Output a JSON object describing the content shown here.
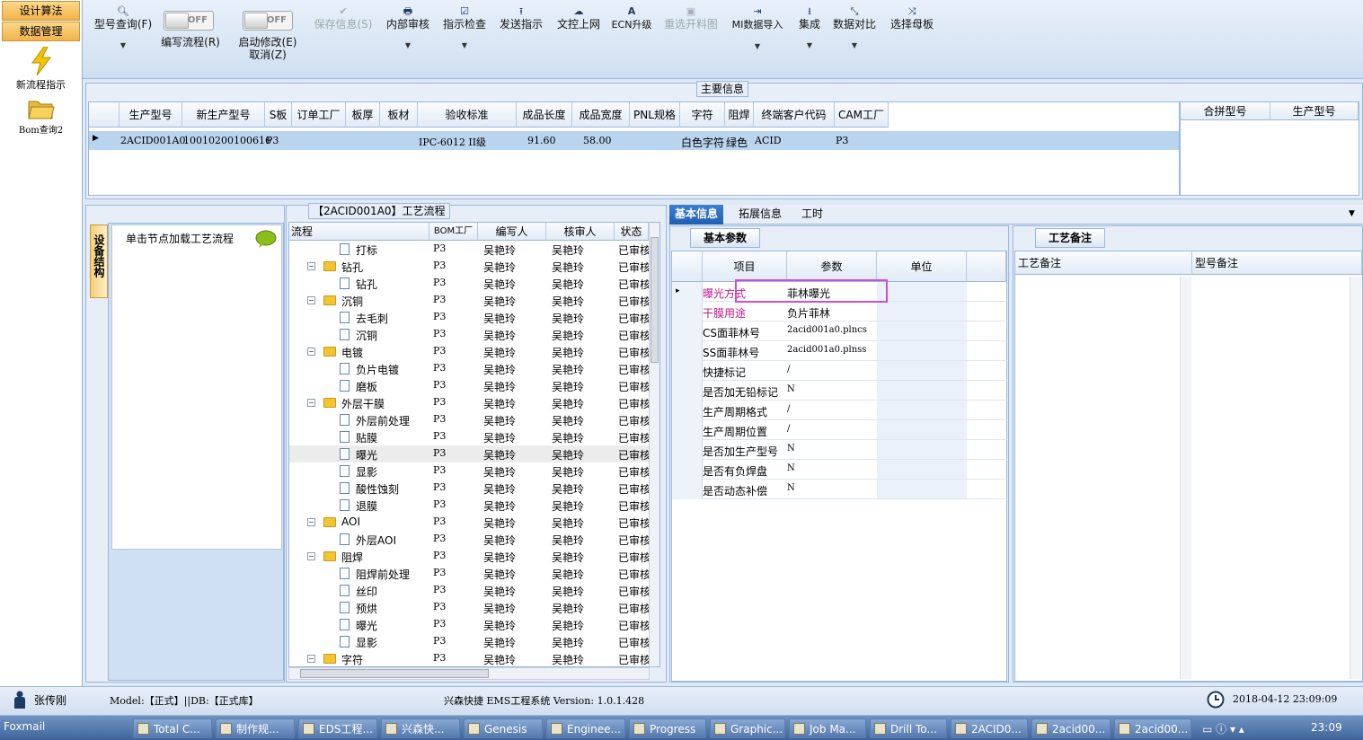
{
  "nav": {
    "tabs": [
      "设计算法",
      "数据管理"
    ],
    "tools": [
      {
        "label": "新流程指示",
        "icon": "lightning-icon"
      },
      {
        "label": "Bom查询2",
        "icon": "folder-open-icon"
      }
    ]
  },
  "ribbon": {
    "buttons": [
      {
        "label": "型号查询(F)",
        "icon": "search-icon",
        "dropdown": true,
        "enabled": true
      },
      {
        "label": "编写流程(R)",
        "toggle": "OFF",
        "enabled": true
      },
      {
        "label": "启动修改(E)",
        "label2": "取消(Z)",
        "toggle": "OFF",
        "enabled": true
      },
      {
        "label": "保存信息(S)",
        "icon": "check-icon",
        "enabled": false
      },
      {
        "label": "内部审核",
        "icon": "print-icon",
        "dropdown": true,
        "enabled": true
      },
      {
        "label": "指示检查",
        "icon": "checkbox-icon",
        "dropdown": true,
        "enabled": true
      },
      {
        "label": "发送指示",
        "icon": "upload-icon",
        "enabled": true
      },
      {
        "label": "文控上网",
        "icon": "cloud-upload-icon",
        "enabled": true
      },
      {
        "label": "ECN升级",
        "icon": "font-icon",
        "enabled": true
      },
      {
        "label": "重选开料图",
        "icon": "image-icon",
        "enabled": false
      },
      {
        "label": "MI数据导入",
        "icon": "import-icon",
        "dropdown": true,
        "enabled": true
      },
      {
        "label": "集成",
        "icon": "download-icon",
        "dropdown": true,
        "enabled": true
      },
      {
        "label": "数据对比",
        "icon": "compress-icon",
        "dropdown": true,
        "enabled": true
      },
      {
        "label": "选择母板",
        "icon": "shuffle-icon",
        "enabled": true
      }
    ]
  },
  "main_info": {
    "title": "主要信息",
    "columns": [
      "生产型号",
      "新生产型号",
      "S板",
      "订单工厂",
      "板厚",
      "板材",
      "验收标准",
      "成品长度",
      "成品宽度",
      "PNL规格",
      "字符",
      "阻焊",
      "终端客户代码",
      "CAM工厂"
    ],
    "row": [
      "2ACID001A0",
      "10010200100616",
      "P3",
      "",
      "",
      "",
      "IPC-6012 II级",
      "91.60",
      "58.00",
      "",
      "白色字符",
      "绿色",
      "ACID",
      "P3"
    ],
    "side_columns": [
      "合拼型号",
      "生产型号"
    ]
  },
  "device": {
    "vertical_tab": "设备结构",
    "hint": "单击节点加载工艺流程"
  },
  "flow": {
    "title": "【2ACID001A0】工艺流程",
    "columns": [
      "流程",
      "BOM工厂",
      "编写人",
      "核审人",
      "状态"
    ],
    "rows": [
      {
        "name": "打标",
        "level": 2,
        "folder": false,
        "bom": "P3",
        "writer": "吴艳玲",
        "reviewer": "吴艳玲",
        "status": "已审核"
      },
      {
        "name": "钻孔",
        "level": 1,
        "folder": true,
        "bom": "P3",
        "writer": "吴艳玲",
        "reviewer": "吴艳玲",
        "status": "已审核"
      },
      {
        "name": "钻孔",
        "level": 2,
        "folder": false,
        "bom": "P3",
        "writer": "吴艳玲",
        "reviewer": "吴艳玲",
        "status": "已审核"
      },
      {
        "name": "沉铜",
        "level": 1,
        "folder": true,
        "bom": "P3",
        "writer": "吴艳玲",
        "reviewer": "吴艳玲",
        "status": "已审核"
      },
      {
        "name": "去毛刺",
        "level": 2,
        "folder": false,
        "bom": "P3",
        "writer": "吴艳玲",
        "reviewer": "吴艳玲",
        "status": "已审核"
      },
      {
        "name": "沉铜",
        "level": 2,
        "folder": false,
        "bom": "P3",
        "writer": "吴艳玲",
        "reviewer": "吴艳玲",
        "status": "已审核"
      },
      {
        "name": "电镀",
        "level": 1,
        "folder": true,
        "bom": "P3",
        "writer": "吴艳玲",
        "reviewer": "吴艳玲",
        "status": "已审核"
      },
      {
        "name": "负片电镀",
        "level": 2,
        "folder": false,
        "bom": "P3",
        "writer": "吴艳玲",
        "reviewer": "吴艳玲",
        "status": "已审核"
      },
      {
        "name": "磨板",
        "level": 2,
        "folder": false,
        "bom": "P3",
        "writer": "吴艳玲",
        "reviewer": "吴艳玲",
        "status": "已审核"
      },
      {
        "name": "外层干膜",
        "level": 1,
        "folder": true,
        "bom": "P3",
        "writer": "吴艳玲",
        "reviewer": "吴艳玲",
        "status": "已审核"
      },
      {
        "name": "外层前处理",
        "level": 2,
        "folder": false,
        "bom": "P3",
        "writer": "吴艳玲",
        "reviewer": "吴艳玲",
        "status": "已审核"
      },
      {
        "name": "贴膜",
        "level": 2,
        "folder": false,
        "bom": "P3",
        "writer": "吴艳玲",
        "reviewer": "吴艳玲",
        "status": "已审核"
      },
      {
        "name": "曝光",
        "level": 2,
        "folder": false,
        "bom": "P3",
        "writer": "吴艳玲",
        "reviewer": "吴艳玲",
        "status": "已审核",
        "selected": true
      },
      {
        "name": "显影",
        "level": 2,
        "folder": false,
        "bom": "P3",
        "writer": "吴艳玲",
        "reviewer": "吴艳玲",
        "status": "已审核"
      },
      {
        "name": "酸性蚀刻",
        "level": 2,
        "folder": false,
        "bom": "P3",
        "writer": "吴艳玲",
        "reviewer": "吴艳玲",
        "status": "已审核"
      },
      {
        "name": "退膜",
        "level": 2,
        "folder": false,
        "bom": "P3",
        "writer": "吴艳玲",
        "reviewer": "吴艳玲",
        "status": "已审核"
      },
      {
        "name": "AOI",
        "level": 1,
        "folder": true,
        "bom": "P3",
        "writer": "吴艳玲",
        "reviewer": "吴艳玲",
        "status": "已审核"
      },
      {
        "name": "外层AOI",
        "level": 2,
        "folder": false,
        "bom": "P3",
        "writer": "吴艳玲",
        "reviewer": "吴艳玲",
        "status": "已审核"
      },
      {
        "name": "阻焊",
        "level": 1,
        "folder": true,
        "bom": "P3",
        "writer": "吴艳玲",
        "reviewer": "吴艳玲",
        "status": "已审核"
      },
      {
        "name": "阻焊前处理",
        "level": 2,
        "folder": false,
        "bom": "P3",
        "writer": "吴艳玲",
        "reviewer": "吴艳玲",
        "status": "已审核"
      },
      {
        "name": "丝印",
        "level": 2,
        "folder": false,
        "bom": "P3",
        "writer": "吴艳玲",
        "reviewer": "吴艳玲",
        "status": "已审核"
      },
      {
        "name": "预烘",
        "level": 2,
        "folder": false,
        "bom": "P3",
        "writer": "吴艳玲",
        "reviewer": "吴艳玲",
        "status": "已审核"
      },
      {
        "name": "曝光",
        "level": 2,
        "folder": false,
        "bom": "P3",
        "writer": "吴艳玲",
        "reviewer": "吴艳玲",
        "status": "已审核"
      },
      {
        "name": "显影",
        "level": 2,
        "folder": false,
        "bom": "P3",
        "writer": "吴艳玲",
        "reviewer": "吴艳玲",
        "status": "已审核"
      },
      {
        "name": "字符",
        "level": 1,
        "folder": true,
        "bom": "P3",
        "writer": "吴艳玲",
        "reviewer": "吴艳玲",
        "status": "已审核"
      }
    ]
  },
  "detail": {
    "tabs": [
      "基本信息",
      "拓展信息",
      "工时"
    ],
    "subtab": "基本参数",
    "columns": [
      "项目",
      "参数",
      "单位"
    ],
    "rows": [
      {
        "item": "曝光方式",
        "value": "菲林曝光",
        "unit": "",
        "highlight": true
      },
      {
        "item": "干膜用途",
        "value": "负片菲林",
        "unit": "",
        "highlight": true
      },
      {
        "item": "CS面菲林号",
        "value": "2acid001a0.plncs",
        "unit": ""
      },
      {
        "item": "SS面菲林号",
        "value": "2acid001a0.plnss",
        "unit": ""
      },
      {
        "item": "快捷标记",
        "value": "/",
        "unit": ""
      },
      {
        "item": "是否加无铅标记",
        "value": "N",
        "unit": ""
      },
      {
        "item": "生产周期格式",
        "value": "/",
        "unit": ""
      },
      {
        "item": "生产周期位置",
        "value": "/",
        "unit": ""
      },
      {
        "item": "是否加生产型号",
        "value": "N",
        "unit": ""
      },
      {
        "item": "是否有负焊盘",
        "value": "N",
        "unit": ""
      },
      {
        "item": "是否动态补偿",
        "value": "N",
        "unit": ""
      }
    ],
    "highlight_color": "#c0188a"
  },
  "remarks": {
    "tab": "工艺备注",
    "columns": [
      "工艺备注",
      "型号备注"
    ]
  },
  "status": {
    "user": "张传刚",
    "model": "Model:【正式】||DB:【正式库】",
    "app": "兴森快捷 EMS工程系统 Version: 1.0.1.428",
    "datetime": "2018-04-12 23:09:09"
  },
  "taskbar": {
    "start": "Foxmail",
    "items": [
      "Total C...",
      "制作规...",
      "EDS工程...",
      "兴森快...",
      "Genesis",
      "Enginee...",
      "Progress",
      "Graphic...",
      "Job Ma...",
      "Drill To...",
      "2ACID0...",
      "2acid00...",
      "2acid00..."
    ],
    "clock": "23:09"
  }
}
